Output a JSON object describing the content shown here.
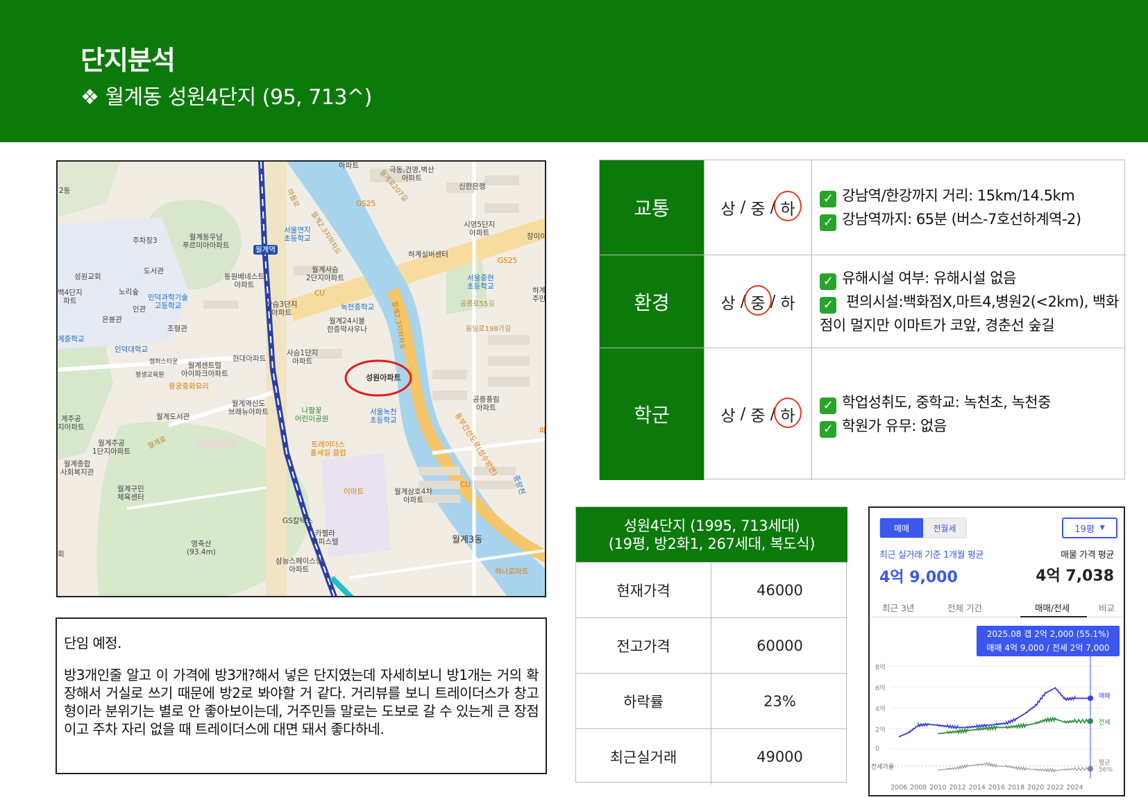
{
  "header": {
    "title": "단지분석",
    "subtitle": "❖ 월계동 성원4단지 (95, 713^)"
  },
  "map": {
    "labels": [
      {
        "id": "l1",
        "text": "2동"
      },
      {
        "id": "l2",
        "text": "아파트"
      },
      {
        "id": "l3",
        "text": "극동,건영,벽산\n아파트"
      },
      {
        "id": "l4",
        "text": "신한은행"
      },
      {
        "id": "l5",
        "text": "GS25"
      },
      {
        "id": "l6",
        "text": "주차장3"
      },
      {
        "id": "l7",
        "text": "월계동우남\n푸르미아아파트"
      },
      {
        "id": "l8",
        "text": "서울연지\n초등학교"
      },
      {
        "id": "l9",
        "text": "월계역"
      },
      {
        "id": "l10",
        "text": "시영5단지\n아파트"
      },
      {
        "id": "l11",
        "text": "장미아"
      },
      {
        "id": "l12",
        "text": "하계실버센터"
      },
      {
        "id": "l13",
        "text": "도서관"
      },
      {
        "id": "l14",
        "text": "성원교회"
      },
      {
        "id": "l15",
        "text": "노리숲"
      },
      {
        "id": "l16",
        "text": "동원베네스트\n아파트"
      },
      {
        "id": "l17",
        "text": "월계사슴\n2단지아파트"
      },
      {
        "id": "l18",
        "text": "GS25"
      },
      {
        "id": "l19",
        "text": "서울중현\n초등학교"
      },
      {
        "id": "l20",
        "text": "백4단지\n파트"
      },
      {
        "id": "l21",
        "text": "인덕과학기술\n고등학교"
      },
      {
        "id": "l22",
        "text": "인관"
      },
      {
        "id": "l23",
        "text": "CU"
      },
      {
        "id": "l24",
        "text": "사슴3단지\n아파트"
      },
      {
        "id": "l25",
        "text": "녹천중학교"
      },
      {
        "id": "l26",
        "text": "공릉로55길"
      },
      {
        "id": "l27",
        "text": "하계\n주민"
      },
      {
        "id": "l28",
        "text": "은봉관"
      },
      {
        "id": "l29",
        "text": "조형관"
      },
      {
        "id": "l30",
        "text": "월계24시불\n한증막사우나"
      },
      {
        "id": "l31",
        "text": "동일로198가길"
      },
      {
        "id": "l32",
        "text": "계중학교"
      },
      {
        "id": "l33",
        "text": "인덕대학교"
      },
      {
        "id": "l34",
        "text": "현대아파트"
      },
      {
        "id": "l35",
        "text": "사슴1단지\n아파트"
      },
      {
        "id": "l36",
        "text": "캠퍼스타운"
      },
      {
        "id": "l37",
        "text": "월계센트럴\n아이파크아파트"
      },
      {
        "id": "l38",
        "text": "평생교육원"
      },
      {
        "id": "l39",
        "text": "성원아파트"
      },
      {
        "id": "l40",
        "text": "용궁중화요리"
      },
      {
        "id": "l41",
        "text": "월계역신도\n브래뉴아파트"
      },
      {
        "id": "l42",
        "text": "공릉풍림\n아파트"
      },
      {
        "id": "l43",
        "text": "계주공\n지아파트"
      },
      {
        "id": "l44",
        "text": "월계도서관"
      },
      {
        "id": "l45",
        "text": "나팔꽃\n어린이공원"
      },
      {
        "id": "l46",
        "text": "서울녹천\n초등학교"
      },
      {
        "id": "l47",
        "text": "월계주공\n1단지아파트"
      },
      {
        "id": "l48",
        "text": "트레이더스\n홀세일 클럽"
      },
      {
        "id": "l49",
        "text": "월계종합\n사회복지관"
      },
      {
        "id": "l50",
        "text": "월계구민\n체육센터"
      },
      {
        "id": "l51",
        "text": "이마트"
      },
      {
        "id": "l52",
        "text": "월계삼호4차\n아파트"
      },
      {
        "id": "l53",
        "text": "CU"
      },
      {
        "id": "l54",
        "text": "GS칼텍스"
      },
      {
        "id": "l55",
        "text": "월계3동"
      },
      {
        "id": "l56",
        "text": "카펠라\n오피스텔"
      },
      {
        "id": "l57",
        "text": "영축산\n(93.4m)"
      },
      {
        "id": "l58",
        "text": "삼능스페이스향\n아파트"
      },
      {
        "id": "l59",
        "text": "하나로마트"
      },
      {
        "id": "l60",
        "text": "동부간선도로(성수방면)"
      },
      {
        "id": "l61",
        "text": "월계2.3지하차도"
      },
      {
        "id": "l62",
        "text": "월계로"
      },
      {
        "id": "l63",
        "text": "마들로"
      },
      {
        "id": "l64",
        "text": "월계로207길"
      },
      {
        "id": "l65",
        "text": "월계2.3지하차도"
      },
      {
        "id": "l66",
        "text": "중랑천"
      },
      {
        "id": "l67",
        "text": "파"
      },
      {
        "id": "l68",
        "text": "회"
      }
    ]
  },
  "note": {
    "p1": "단임 예정.",
    "p2": "방3개인줄 알고 이 가격에 방3개?해서 넣은 단지였는데 자세히보니 방1개는 거의 확장해서 거실로 쓰기 때문에 방2로 봐야할 거 같다. 거리뷰를 보니 트레이더스가 창고형이라 분위기는 별로 안 좋아보이는데, 거주민들 말로는 도보로 갈 수 있는게 큰 장점이고 주차 자리 없을 때 트레이더스에 대면 돼서 좋다하네."
  },
  "analysis": {
    "grade_labels": [
      "상",
      "중",
      "하"
    ],
    "rows": [
      {
        "category": "교통",
        "selected": "하",
        "lines": [
          "강남역/한강까지 거리: 15km/14.5km",
          "강남역까지: 65분 (버스-7호선하계역-2)"
        ]
      },
      {
        "category": "환경",
        "selected": "중",
        "lines": [
          "유해시설 여부: 유해시설 없음",
          " 편의시설:백화점X,마트4,병원2(<2km), 백화점이 멀지만 이마트가 코앞, 경춘선 숲길"
        ]
      },
      {
        "category": "학군",
        "selected": "하",
        "lines": [
          "학업성취도, 중학교: 녹천초, 녹천중",
          "학원가 유무: 없음"
        ]
      }
    ]
  },
  "price_table": {
    "header_line1": "성원4단지 (1995, 713세대)",
    "header_line2": "(19평, 방2화1, 267세대, 복도식)",
    "rows": [
      {
        "label": "현재가격",
        "value": "46000"
      },
      {
        "label": "전고가격",
        "value": "60000"
      },
      {
        "label": "하락률",
        "value": "23%"
      },
      {
        "label": "최근실거래",
        "value": "49000"
      }
    ]
  },
  "widget": {
    "tab_active": "매매",
    "tab_inactive": "전월세",
    "size_select": "19평",
    "caption_left": "최근 실거래 기준 1개월 평균",
    "caption_right": "매물 가격 평균",
    "value_left": "4억 9,000",
    "value_right": "4억 7,038",
    "nav": [
      "최근 3년",
      "전체 기간",
      "매매/전세",
      "비교"
    ],
    "nav_active": "매매/전세",
    "tooltip_line1": "2025.08  갭 2억 2,000 (55.1%)",
    "tooltip_line2": "매매 4억 9,000 / 전세 2억 7,000",
    "colors": {
      "sale": "#3b3bdd",
      "jeonse": "#2f8f3f",
      "ratio": "#888888",
      "accent": "#3b57f0"
    }
  },
  "chart_data": {
    "type": "line",
    "x": [
      2006,
      2007,
      2008,
      2009,
      2010,
      2011,
      2012,
      2013,
      2014,
      2015,
      2016,
      2017,
      2018,
      2019,
      2020,
      2021,
      2022,
      2023,
      2024,
      2025.6
    ],
    "x_ticks": [
      "2006",
      "2008",
      "2010",
      "2012",
      "2014",
      "2016",
      "2018",
      "2020",
      "2022",
      "2024"
    ],
    "y_ticks": [
      "8억",
      "6억",
      "4억",
      "2억",
      "0"
    ],
    "ylim": [
      0,
      8
    ],
    "series": [
      {
        "name": "매매",
        "values": [
          1.2,
          1.6,
          2.3,
          2.4,
          2.3,
          2.2,
          2.1,
          2.1,
          2.2,
          2.3,
          2.4,
          2.5,
          2.9,
          3.5,
          4.2,
          5.4,
          5.9,
          4.8,
          4.9,
          4.9
        ]
      },
      {
        "name": "전세",
        "values": [
          null,
          null,
          null,
          null,
          1.5,
          1.6,
          1.7,
          1.8,
          1.9,
          2.0,
          2.1,
          2.1,
          2.2,
          2.3,
          2.5,
          2.8,
          2.9,
          2.6,
          2.7,
          2.7
        ]
      },
      {
        "name": "전세가율",
        "values": [
          null,
          null,
          null,
          null,
          0.5,
          0.55,
          0.6,
          0.7,
          0.75,
          0.8,
          0.7,
          0.68,
          0.6,
          0.56,
          0.52,
          0.5,
          0.48,
          0.52,
          0.55,
          0.56
        ]
      }
    ],
    "series_labels": {
      "sale": "매매",
      "jeonse": "전세",
      "ratio": "전세가율",
      "ratio_end": "평균\n56%"
    }
  }
}
